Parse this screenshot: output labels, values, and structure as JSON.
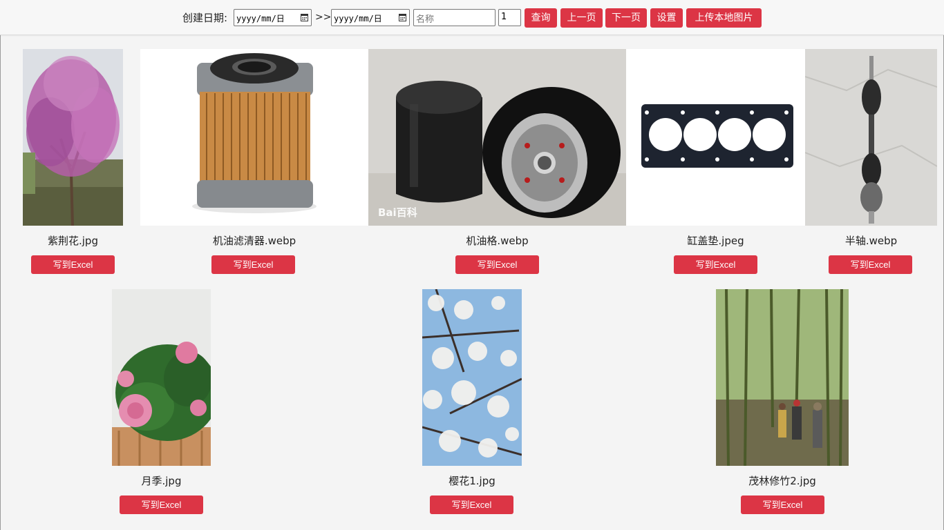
{
  "toolbar": {
    "date_label": "创建日期:",
    "date_placeholder": "yyyy/mm/日",
    "range_sep": ">>",
    "name_placeholder": "名称",
    "page_value": "1",
    "query_label": "查询",
    "prev_label": "上一页",
    "next_label": "下一页",
    "settings_label": "设置",
    "upload_label": "上传本地图片"
  },
  "gallery": {
    "row1": [
      {
        "name": "紫荆花.jpg",
        "button": "写到Excel"
      },
      {
        "name": "机油滤清器.webp",
        "button": "写到Excel"
      },
      {
        "name": "机油格.webp",
        "button": "写到Excel"
      },
      {
        "name": "缸盖垫.jpeg",
        "button": "写到Excel"
      },
      {
        "name": "半轴.webp",
        "button": "写到Excel"
      }
    ],
    "row2": [
      {
        "name": "月季.jpg",
        "button": "写到Excel"
      },
      {
        "name": "樱花1.jpg",
        "button": "写到Excel"
      },
      {
        "name": "茂林修竹2.jpg",
        "button": "写到Excel"
      }
    ],
    "watermark": "Bai百科"
  },
  "colors": {
    "accent": "#dc3545",
    "background": "#f4f4f4"
  }
}
